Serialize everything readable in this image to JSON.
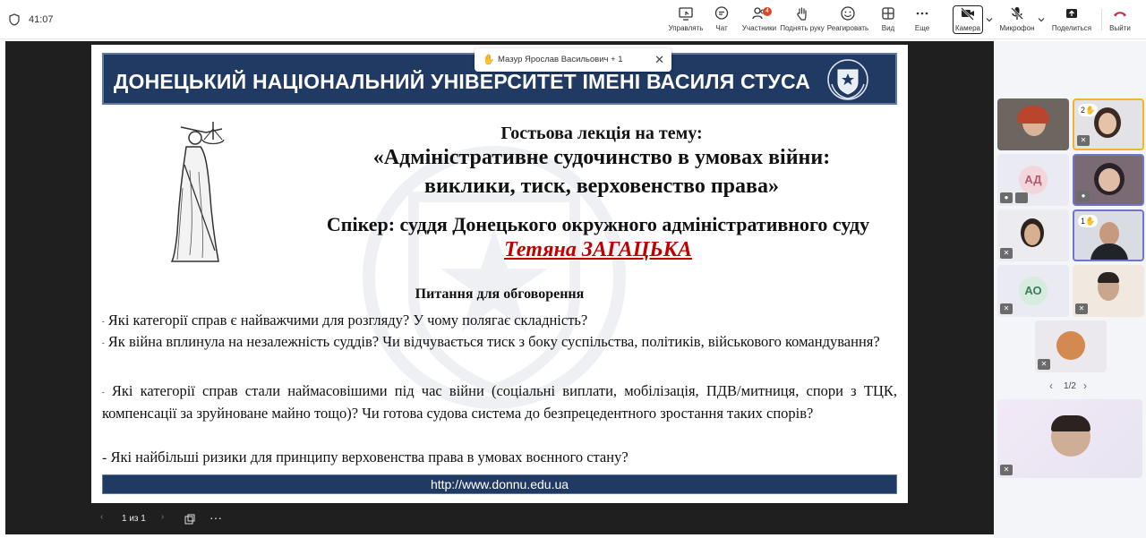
{
  "topbar": {
    "timer": "41:07",
    "buttons": [
      {
        "id": "manage",
        "label": "Управлять",
        "icon": "present-screen-icon"
      },
      {
        "id": "chat",
        "label": "Чат",
        "icon": "chat-icon"
      },
      {
        "id": "people",
        "label": "Участники",
        "icon": "people-icon",
        "badge": "4"
      },
      {
        "id": "raise",
        "label": "Поднять руку",
        "icon": "hand-icon"
      },
      {
        "id": "react",
        "label": "Реагировать",
        "icon": "smiley-icon"
      },
      {
        "id": "view",
        "label": "Вид",
        "icon": "grid-view-icon"
      },
      {
        "id": "more",
        "label": "Еще",
        "icon": "more-dots-icon"
      },
      {
        "id": "camera",
        "label": "Камера",
        "icon": "camera-off-icon"
      },
      {
        "id": "mic",
        "label": "Микрофон",
        "icon": "mic-off-icon"
      },
      {
        "id": "share",
        "label": "Поделиться",
        "icon": "share-screen-icon"
      },
      {
        "id": "leave",
        "label": "Выйти",
        "icon": "phone-hangup-icon",
        "color": "#c4314b"
      }
    ]
  },
  "raised_hand_popup": {
    "text": "Мазур Ярослав Васильович + 1",
    "close": "✕"
  },
  "slide": {
    "banner_title": "ДОНЕЦЬКИЙ НАЦІОНАЛЬНИЙ УНІВЕРСИТЕТ ІМЕНІ ВАСИЛЯ СТУСА",
    "lecture_heading": "Гостьова лекція на тему:",
    "topic_line1": "«Адміністративне судочинство в умовах війни:",
    "topic_line2": "виклики, тиск, верховенство права»",
    "speaker": "Спікер: суддя Донецького окружного адміністративного суду",
    "speaker_name": "Тетяна ЗАГАЦЬКА",
    "questions_title": "Питання для обговорення",
    "questions": [
      {
        "dash": "-",
        "text": "Які категорії справ є найважчими для розгляду? У чому полягає складність?"
      },
      {
        "dash": "-",
        "text": "Як війна вплинула на незалежність суддів? Чи відчувається тиск з боку суспільства, політиків, військового командування?"
      },
      {
        "dash": "-",
        "text": "Які категорії справ стали наймасовішими під час війни (соціальні виплати, мобілізація, ПДВ/митниця, спори з ТЦК, компенсації за зруйноване майно тощо)? Чи готова судова система до безпрецедентного зростання таких спорів?"
      },
      {
        "dash": "-",
        "text": "Які найбільші ризики для принципу верховенства права в умовах воєнного стану?"
      }
    ],
    "footer_url": "http://www.donnu.edu.ua",
    "colors": {
      "banner": "#213a63",
      "name": "#c00000"
    }
  },
  "slide_controls": {
    "page": "1 из 1"
  },
  "participants": [
    {
      "id": "p1",
      "type": "video"
    },
    {
      "id": "p2",
      "type": "video",
      "hand": "2"
    },
    {
      "id": "p3",
      "type": "initials",
      "initials": "АД",
      "bg": "#f3d6dc",
      "fg": "#b35b6f"
    },
    {
      "id": "p4",
      "type": "video"
    },
    {
      "id": "p5",
      "type": "video"
    },
    {
      "id": "p6",
      "type": "video",
      "hand": "1"
    },
    {
      "id": "p7",
      "type": "initials",
      "initials": "АО",
      "bg": "#d5ecdf",
      "fg": "#3d7b5b"
    },
    {
      "id": "p8",
      "type": "video"
    },
    {
      "id": "p9",
      "type": "video"
    },
    {
      "id": "p10",
      "type": "video"
    }
  ],
  "pager": {
    "text": "1/2"
  }
}
